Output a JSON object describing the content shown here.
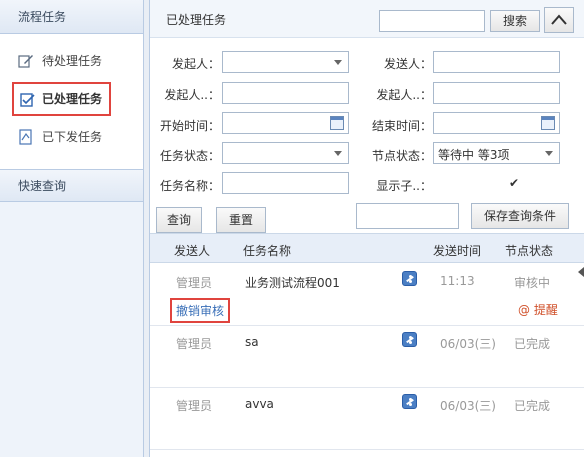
{
  "sidebar": {
    "header": "流程任务",
    "items": [
      {
        "label": "待处理任务",
        "icon": "edit-icon"
      },
      {
        "label": "已处理任务",
        "icon": "checked-edit-icon"
      },
      {
        "label": "已下发任务",
        "icon": "send-doc-icon"
      }
    ],
    "quick_query": "快速查询"
  },
  "main": {
    "title": "已处理任务",
    "search_button": "搜索",
    "search_value": ""
  },
  "form": {
    "initiator_label": "发起人：",
    "sender_label": "发送人：",
    "initiator2_label": "发起人..：",
    "sender2_label": "发起人..：",
    "start_time_label": "开始时间：",
    "end_time_label": "结束时间：",
    "task_status_label": "任务状态：",
    "node_status_label": "节点状态：",
    "node_status_value": "等待中 等3项",
    "task_name_label": "任务名称：",
    "show_sub_label": "显示子..：",
    "show_sub_checked": "✔",
    "query_button": "查询",
    "reset_button": "重置",
    "save_query_button": "保存查询条件"
  },
  "table": {
    "columns": [
      "发送人",
      "任务名称",
      "发送时间",
      "节点状态"
    ],
    "rows": [
      {
        "sender": "管理员",
        "task": "业务测试流程001",
        "time": "11:13",
        "status": "审核中"
      },
      {
        "sender": "管理员",
        "task": "sa",
        "time": "06/03(三)",
        "status": "已完成"
      },
      {
        "sender": "管理员",
        "task": "avva",
        "time": "06/03(三)",
        "status": "已完成"
      }
    ],
    "undo_label": "撤销审核",
    "remind_label": "@ 提醒"
  }
}
